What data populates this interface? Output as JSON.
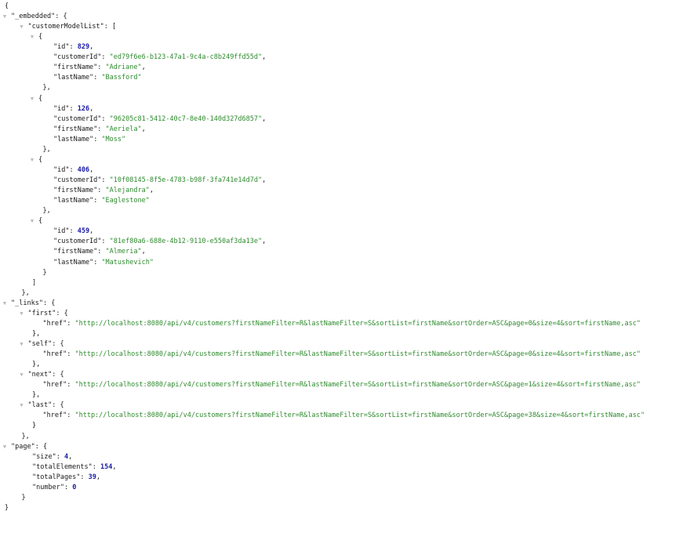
{
  "json_lines": [
    {
      "indent": 0,
      "toggle": false,
      "parts": [
        [
          "pun",
          "{"
        ]
      ]
    },
    {
      "indent": 0,
      "toggle": true,
      "parts": [
        [
          "key",
          "\"_embedded\""
        ],
        [
          "pun",
          ": {"
        ]
      ]
    },
    {
      "indent": 1,
      "toggle": true,
      "parts": [
        [
          "key",
          "\"customerModelList\""
        ],
        [
          "pun",
          ": ["
        ]
      ]
    },
    {
      "indent": 2,
      "toggle": true,
      "parts": [
        [
          "pun",
          "{"
        ]
      ]
    },
    {
      "indent": 4,
      "toggle": false,
      "parts": [
        [
          "key",
          "\"id\""
        ],
        [
          "pun",
          ": "
        ],
        [
          "num",
          "829"
        ],
        [
          "pun",
          ","
        ]
      ]
    },
    {
      "indent": 4,
      "toggle": false,
      "parts": [
        [
          "key",
          "\"customerId\""
        ],
        [
          "pun",
          ": "
        ],
        [
          "str",
          "\"ed79f6e6-b123-47a1-9c4a-c8b249ffd55d\""
        ],
        [
          "pun",
          ","
        ]
      ]
    },
    {
      "indent": 4,
      "toggle": false,
      "parts": [
        [
          "key",
          "\"firstName\""
        ],
        [
          "pun",
          ": "
        ],
        [
          "str",
          "\"Adriane\""
        ],
        [
          "pun",
          ","
        ]
      ]
    },
    {
      "indent": 4,
      "toggle": false,
      "parts": [
        [
          "key",
          "\"lastName\""
        ],
        [
          "pun",
          ": "
        ],
        [
          "str",
          "\"Bassford\""
        ]
      ]
    },
    {
      "indent": 3,
      "toggle": false,
      "parts": [
        [
          "pun",
          "},"
        ]
      ]
    },
    {
      "indent": 2,
      "toggle": true,
      "parts": [
        [
          "pun",
          "{"
        ]
      ]
    },
    {
      "indent": 4,
      "toggle": false,
      "parts": [
        [
          "key",
          "\"id\""
        ],
        [
          "pun",
          ": "
        ],
        [
          "num",
          "126"
        ],
        [
          "pun",
          ","
        ]
      ]
    },
    {
      "indent": 4,
      "toggle": false,
      "parts": [
        [
          "key",
          "\"customerId\""
        ],
        [
          "pun",
          ": "
        ],
        [
          "str",
          "\"96205c81-5412-40c7-8e40-140d327d6857\""
        ],
        [
          "pun",
          ","
        ]
      ]
    },
    {
      "indent": 4,
      "toggle": false,
      "parts": [
        [
          "key",
          "\"firstName\""
        ],
        [
          "pun",
          ": "
        ],
        [
          "str",
          "\"Aeriela\""
        ],
        [
          "pun",
          ","
        ]
      ]
    },
    {
      "indent": 4,
      "toggle": false,
      "parts": [
        [
          "key",
          "\"lastName\""
        ],
        [
          "pun",
          ": "
        ],
        [
          "str",
          "\"Moss\""
        ]
      ]
    },
    {
      "indent": 3,
      "toggle": false,
      "parts": [
        [
          "pun",
          "},"
        ]
      ]
    },
    {
      "indent": 2,
      "toggle": true,
      "parts": [
        [
          "pun",
          "{"
        ]
      ]
    },
    {
      "indent": 4,
      "toggle": false,
      "parts": [
        [
          "key",
          "\"id\""
        ],
        [
          "pun",
          ": "
        ],
        [
          "num",
          "406"
        ],
        [
          "pun",
          ","
        ]
      ]
    },
    {
      "indent": 4,
      "toggle": false,
      "parts": [
        [
          "key",
          "\"customerId\""
        ],
        [
          "pun",
          ": "
        ],
        [
          "str",
          "\"10f08145-8f5e-4783-b98f-3fa741e14d7d\""
        ],
        [
          "pun",
          ","
        ]
      ]
    },
    {
      "indent": 4,
      "toggle": false,
      "parts": [
        [
          "key",
          "\"firstName\""
        ],
        [
          "pun",
          ": "
        ],
        [
          "str",
          "\"Alejandra\""
        ],
        [
          "pun",
          ","
        ]
      ]
    },
    {
      "indent": 4,
      "toggle": false,
      "parts": [
        [
          "key",
          "\"lastName\""
        ],
        [
          "pun",
          ": "
        ],
        [
          "str",
          "\"Eaglestone\""
        ]
      ]
    },
    {
      "indent": 3,
      "toggle": false,
      "parts": [
        [
          "pun",
          "},"
        ]
      ]
    },
    {
      "indent": 2,
      "toggle": true,
      "parts": [
        [
          "pun",
          "{"
        ]
      ]
    },
    {
      "indent": 4,
      "toggle": false,
      "parts": [
        [
          "key",
          "\"id\""
        ],
        [
          "pun",
          ": "
        ],
        [
          "num",
          "459"
        ],
        [
          "pun",
          ","
        ]
      ]
    },
    {
      "indent": 4,
      "toggle": false,
      "parts": [
        [
          "key",
          "\"customerId\""
        ],
        [
          "pun",
          ": "
        ],
        [
          "str",
          "\"81ef80a6-688e-4b12-9110-e550af3da13e\""
        ],
        [
          "pun",
          ","
        ]
      ]
    },
    {
      "indent": 4,
      "toggle": false,
      "parts": [
        [
          "key",
          "\"firstName\""
        ],
        [
          "pun",
          ": "
        ],
        [
          "str",
          "\"Almeria\""
        ],
        [
          "pun",
          ","
        ]
      ]
    },
    {
      "indent": 4,
      "toggle": false,
      "parts": [
        [
          "key",
          "\"lastName\""
        ],
        [
          "pun",
          ": "
        ],
        [
          "str",
          "\"Matushevich\""
        ]
      ]
    },
    {
      "indent": 3,
      "toggle": false,
      "parts": [
        [
          "pun",
          "}"
        ]
      ]
    },
    {
      "indent": 2,
      "toggle": false,
      "parts": [
        [
          "pun",
          "]"
        ]
      ]
    },
    {
      "indent": 1,
      "toggle": false,
      "parts": [
        [
          "pun",
          "},"
        ]
      ]
    },
    {
      "indent": 0,
      "toggle": true,
      "parts": [
        [
          "key",
          "\"_links\""
        ],
        [
          "pun",
          ": {"
        ]
      ]
    },
    {
      "indent": 1,
      "toggle": true,
      "parts": [
        [
          "key",
          "\"first\""
        ],
        [
          "pun",
          ": {"
        ]
      ]
    },
    {
      "indent": 3,
      "toggle": false,
      "parts": [
        [
          "key",
          "\"href\""
        ],
        [
          "pun",
          ": "
        ],
        [
          "str",
          "\"http://localhost:8080/api/v4/customers?firstNameFilter=R&lastNameFilter=S&sortList=firstName&sortOrder=ASC&page=0&size=4&sort=firstName,asc\""
        ]
      ]
    },
    {
      "indent": 2,
      "toggle": false,
      "parts": [
        [
          "pun",
          "},"
        ]
      ]
    },
    {
      "indent": 1,
      "toggle": true,
      "parts": [
        [
          "key",
          "\"self\""
        ],
        [
          "pun",
          ": {"
        ]
      ]
    },
    {
      "indent": 3,
      "toggle": false,
      "parts": [
        [
          "key",
          "\"href\""
        ],
        [
          "pun",
          ": "
        ],
        [
          "str",
          "\"http://localhost:8080/api/v4/customers?firstNameFilter=R&lastNameFilter=S&sortList=firstName&sortOrder=ASC&page=0&size=4&sort=firstName,asc\""
        ]
      ]
    },
    {
      "indent": 2,
      "toggle": false,
      "parts": [
        [
          "pun",
          "},"
        ]
      ]
    },
    {
      "indent": 1,
      "toggle": true,
      "parts": [
        [
          "key",
          "\"next\""
        ],
        [
          "pun",
          ": {"
        ]
      ]
    },
    {
      "indent": 3,
      "toggle": false,
      "parts": [
        [
          "key",
          "\"href\""
        ],
        [
          "pun",
          ": "
        ],
        [
          "str",
          "\"http://localhost:8080/api/v4/customers?firstNameFilter=R&lastNameFilter=S&sortList=firstName&sortOrder=ASC&page=1&size=4&sort=firstName,asc\""
        ]
      ]
    },
    {
      "indent": 2,
      "toggle": false,
      "parts": [
        [
          "pun",
          "},"
        ]
      ]
    },
    {
      "indent": 1,
      "toggle": true,
      "parts": [
        [
          "key",
          "\"last\""
        ],
        [
          "pun",
          ": {"
        ]
      ]
    },
    {
      "indent": 3,
      "toggle": false,
      "parts": [
        [
          "key",
          "\"href\""
        ],
        [
          "pun",
          ": "
        ],
        [
          "str",
          "\"http://localhost:8080/api/v4/customers?firstNameFilter=R&lastNameFilter=S&sortList=firstName&sortOrder=ASC&page=38&size=4&sort=firstName,asc\""
        ]
      ]
    },
    {
      "indent": 2,
      "toggle": false,
      "parts": [
        [
          "pun",
          "}"
        ]
      ]
    },
    {
      "indent": 1,
      "toggle": false,
      "parts": [
        [
          "pun",
          "},"
        ]
      ]
    },
    {
      "indent": 0,
      "toggle": true,
      "parts": [
        [
          "key",
          "\"page\""
        ],
        [
          "pun",
          ": {"
        ]
      ]
    },
    {
      "indent": 2,
      "toggle": false,
      "parts": [
        [
          "key",
          "\"size\""
        ],
        [
          "pun",
          ": "
        ],
        [
          "num",
          "4"
        ],
        [
          "pun",
          ","
        ]
      ]
    },
    {
      "indent": 2,
      "toggle": false,
      "parts": [
        [
          "key",
          "\"totalElements\""
        ],
        [
          "pun",
          ": "
        ],
        [
          "num",
          "154"
        ],
        [
          "pun",
          ","
        ]
      ]
    },
    {
      "indent": 2,
      "toggle": false,
      "parts": [
        [
          "key",
          "\"totalPages\""
        ],
        [
          "pun",
          ": "
        ],
        [
          "num",
          "39"
        ],
        [
          "pun",
          ","
        ]
      ]
    },
    {
      "indent": 2,
      "toggle": false,
      "parts": [
        [
          "key",
          "\"number\""
        ],
        [
          "pun",
          ": "
        ],
        [
          "num",
          "0"
        ]
      ]
    },
    {
      "indent": 1,
      "toggle": false,
      "parts": [
        [
          "pun",
          "}"
        ]
      ]
    },
    {
      "indent": 0,
      "toggle": false,
      "parts": [
        [
          "pun",
          "}"
        ]
      ]
    }
  ],
  "toggle_icon": "collapse-triangle-icon",
  "colors": {
    "key": "#1a1a1a",
    "string": "#2e8b2e",
    "number": "#1a1aa6",
    "toggle": "#b8b8b8"
  }
}
